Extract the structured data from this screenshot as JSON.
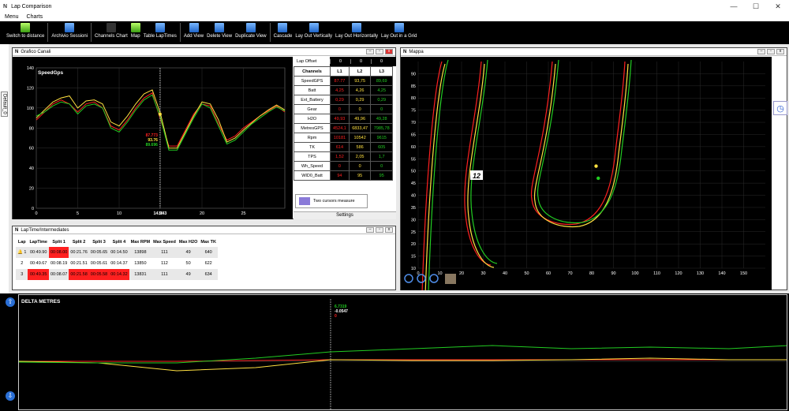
{
  "app": {
    "logo": "N",
    "title": "Lap Comparison"
  },
  "window_controls": [
    "—",
    "☐",
    "✕"
  ],
  "menu": [
    "Menu",
    "Charts"
  ],
  "toolbar": [
    {
      "label": "Switch to distance",
      "icon": "ruler-triangle-icon"
    },
    {
      "label": "Archivio Sessioni",
      "icon": "archive-icon"
    },
    {
      "label": "Channels Chart",
      "icon": "wave-icon"
    },
    {
      "label": "Map",
      "icon": "map-icon"
    },
    {
      "label": "Table LapTimes",
      "icon": "table-icon"
    },
    {
      "label": "Add View",
      "icon": "add-view-icon"
    },
    {
      "label": "Delete View",
      "icon": "delete-view-icon"
    },
    {
      "label": "Duplicate View",
      "icon": "duplicate-view-icon"
    },
    {
      "label": "Cascade",
      "icon": "cascade-icon"
    },
    {
      "label": "Lay Out Vertically",
      "icon": "layout-vertical-icon"
    },
    {
      "label": "Lay Out Horizontally",
      "icon": "layout-horizontal-icon"
    },
    {
      "label": "Lay Out in a Grid",
      "icon": "layout-grid-icon"
    }
  ],
  "side_tab": "Default_0",
  "colors": {
    "lap1": "#ff2020",
    "lap2": "#ffe040",
    "lap3": "#22cc22",
    "highlight": "#ff2020",
    "cursor": "#ffffff"
  },
  "grafico": {
    "title": "Grafico Canali",
    "channel_label": "SpeedGps",
    "cursor_x": "14.943",
    "cursor_values": [
      "87.773",
      "93.76",
      "89.696"
    ],
    "lap_offset_label": "Lap Offset",
    "lap_offsets": [
      "0",
      "0",
      "0"
    ],
    "table_headers": [
      "Channels",
      "L1",
      "L2",
      "L3"
    ],
    "rows": [
      {
        "name": "SpeedGPS",
        "v": [
          "87.77",
          "93,75",
          "89,69"
        ]
      },
      {
        "name": "Batt",
        "v": [
          "4,25",
          "4,26",
          "4,25"
        ]
      },
      {
        "name": "Ext_Battery",
        "v": [
          "0,29",
          "0,29",
          "0,29"
        ]
      },
      {
        "name": "Gear",
        "v": [
          "0",
          "0",
          "0"
        ]
      },
      {
        "name": "H2O",
        "v": [
          "49,93",
          "49,96",
          "49,28"
        ]
      },
      {
        "name": "MetresGPS",
        "v": [
          "4524,1",
          "6833,47",
          "7985,78"
        ]
      },
      {
        "name": "Rpm",
        "v": [
          "10181",
          "10542",
          "9615"
        ]
      },
      {
        "name": "TK",
        "v": [
          "614",
          "586",
          "605"
        ]
      },
      {
        "name": "TPS",
        "v": [
          "1,52",
          "2,05",
          "1,7"
        ]
      },
      {
        "name": "Wh_Speed",
        "v": [
          "0",
          "0",
          "0"
        ]
      },
      {
        "name": "WID0_Batt",
        "v": [
          "94",
          "95",
          "95"
        ]
      }
    ],
    "cursor_mode": "Two cursors measure",
    "settings_label": "Settings"
  },
  "chart_data": [
    {
      "type": "line",
      "title": "SpeedGps",
      "xlim": [
        0,
        30
      ],
      "ylim": [
        0,
        140
      ],
      "xticks": [
        "0",
        "5",
        "10",
        "15",
        "20",
        "25"
      ],
      "yticks": [
        "0",
        "20",
        "40",
        "60",
        "80",
        "100",
        "120",
        "140"
      ],
      "grid": true,
      "x": [
        0,
        1,
        2,
        3,
        4,
        5,
        6,
        7,
        8,
        9,
        10,
        11,
        12,
        13,
        14,
        15,
        16,
        17,
        18,
        19,
        20,
        21,
        22,
        23,
        24,
        25,
        26,
        27,
        28,
        29,
        30
      ],
      "series": [
        {
          "values": [
            88,
            96,
            104,
            108,
            104,
            96,
            104,
            106,
            100,
            82,
            78,
            88,
            100,
            110,
            115,
            88,
            62,
            62,
            78,
            94,
            104,
            102,
            84,
            68,
            72,
            80,
            86,
            92,
            97,
            102,
            96
          ]
        },
        {
          "values": [
            90,
            98,
            106,
            110,
            112,
            100,
            107,
            108,
            104,
            86,
            82,
            92,
            104,
            114,
            118,
            94,
            60,
            60,
            76,
            92,
            106,
            104,
            88,
            66,
            70,
            78,
            85,
            92,
            98,
            103,
            98
          ]
        },
        {
          "values": [
            92,
            96,
            102,
            106,
            104,
            94,
            102,
            104,
            100,
            80,
            76,
            86,
            98,
            108,
            113,
            90,
            58,
            58,
            74,
            90,
            104,
            100,
            82,
            64,
            68,
            76,
            84,
            90,
            96,
            101,
            97
          ]
        }
      ]
    },
    {
      "type": "scatter",
      "title": "Mappa",
      "xlim": [
        0,
        160
      ],
      "ylim": [
        10,
        95
      ],
      "xticks": [
        "0",
        "10",
        "20",
        "30",
        "40",
        "50",
        "60",
        "70",
        "80",
        "90",
        "100",
        "110",
        "120",
        "130",
        "140",
        "150"
      ],
      "yticks": [
        "10",
        "15",
        "20",
        "25",
        "30",
        "35",
        "40",
        "45",
        "50",
        "55",
        "60",
        "65",
        "70",
        "75",
        "80",
        "85",
        "90"
      ],
      "grid": true,
      "annotation": "12"
    },
    {
      "type": "line",
      "title": "DELTA METRES",
      "cursor_values": [
        "6.7319",
        "-0.0547",
        "0"
      ]
    }
  ],
  "mappa": {
    "title": "Mappa",
    "zoom_in": "zoom-in-icon",
    "zoom_out": "zoom-out-icon",
    "zoom_fit": "zoom-fit-icon",
    "map_thumb": "satellite-thumb-icon",
    "clock": "clock-icon"
  },
  "laptime": {
    "title": "LapTime/Intermediates",
    "headers": [
      "Lap",
      "LapTime",
      "Split 1",
      "Split 2",
      "Split 3",
      "Split 4",
      "Max RPM",
      "Max Speed",
      "Max H2O",
      "Max TK"
    ],
    "rows": [
      {
        "lap": "1",
        "cells": [
          "00:49.90",
          "00:08.00",
          "00:21.76",
          "00:05.65",
          "00:14.50",
          "13898",
          "111",
          "49",
          "640"
        ],
        "red": [
          1
        ]
      },
      {
        "lap": "2",
        "cells": [
          "00:49.67",
          "00:08.19",
          "00:21.51",
          "00:05.61",
          "00:14.37",
          "13850",
          "112",
          "50",
          "622"
        ],
        "red": []
      },
      {
        "lap": "3",
        "cells": [
          "00:49.35",
          "00:08.07",
          "00:21.58",
          "00:05.58",
          "00:14.32",
          "13831",
          "111",
          "49",
          "634"
        ],
        "red": [
          0,
          2,
          3,
          4
        ]
      }
    ]
  },
  "delta": {
    "title": "DELTA METRES",
    "values": [
      "6.7319",
      "-0.0547",
      "0"
    ]
  }
}
